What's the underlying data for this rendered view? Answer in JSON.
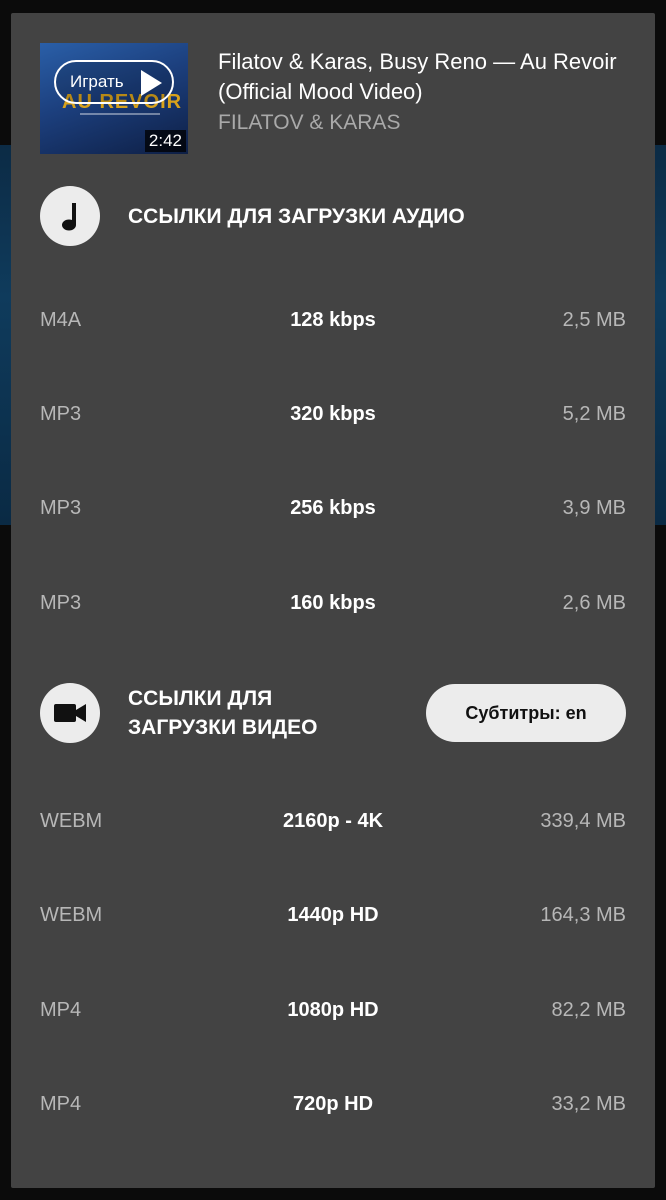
{
  "video": {
    "play_label": "Играть",
    "duration": "2:42",
    "title": "Filatov & Karas, Busy Reno — Au Revoir (Official Mood Video)",
    "channel": "FILATOV & KARAS"
  },
  "audio_section": {
    "icon": "music-note-icon",
    "title": "ССЫЛКИ ДЛЯ ЗАГРУЗКИ АУДИО",
    "rows": [
      {
        "format": "M4A",
        "quality": "128 kbps",
        "size": "2,5 MB"
      },
      {
        "format": "MP3",
        "quality": "320 kbps",
        "size": "5,2 MB"
      },
      {
        "format": "MP3",
        "quality": "256 kbps",
        "size": "3,9 MB"
      },
      {
        "format": "MP3",
        "quality": "160 kbps",
        "size": "2,6 MB"
      }
    ]
  },
  "video_section": {
    "icon": "video-camera-icon",
    "title_line1": "ССЫЛКИ ДЛЯ",
    "title_line2": "ЗАГРУЗКИ ВИДЕО",
    "subtitles_button": "Субтитры: en",
    "rows": [
      {
        "format": "WEBM",
        "quality": "2160p - 4K",
        "size": "339,4 MB"
      },
      {
        "format": "WEBM",
        "quality": "1440p HD",
        "size": "164,3 MB"
      },
      {
        "format": "MP4",
        "quality": "1080p HD",
        "size": "82,2 MB"
      },
      {
        "format": "MP4",
        "quality": "720p HD",
        "size": "33,2 MB"
      }
    ]
  },
  "colors": {
    "sheet": "#434343",
    "icon_circle": "#ececec",
    "muted_text": "#b7b7b7"
  }
}
